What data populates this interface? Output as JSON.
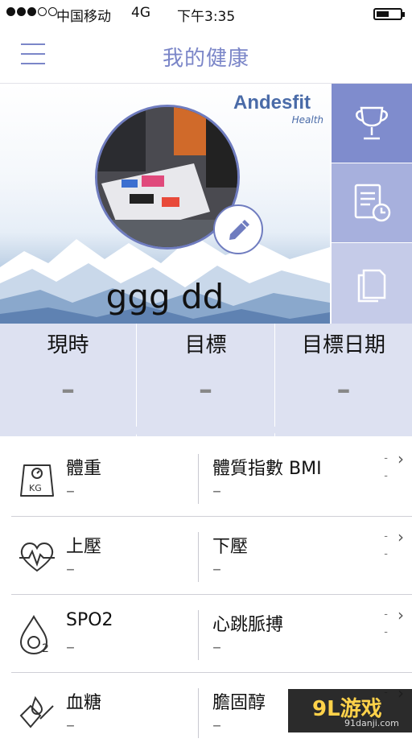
{
  "status_bar": {
    "carrier": "中国移动",
    "network": "4G",
    "time": "下午3:35",
    "signal_bars_on": 3,
    "battery_level": 0.55
  },
  "header": {
    "title": "我的健康",
    "menu_icon": "hamburger-menu-icon"
  },
  "profile": {
    "brand_name": "Andesfit",
    "brand_sub": "Health",
    "username": "ggg dd",
    "edit_icon": "pencil-icon"
  },
  "side_tabs": [
    {
      "icon": "trophy-icon"
    },
    {
      "icon": "report-clock-icon"
    },
    {
      "icon": "documents-icon"
    }
  ],
  "summary": {
    "current_label": "現時",
    "current_value": "–",
    "target_label": "目標",
    "target_value": "–",
    "target_date_label": "目標日期",
    "target_date_value": "–"
  },
  "rows": [
    {
      "icon": "scale-icon",
      "left_name": "體重",
      "left_value": "–",
      "right_name": "體質指數 BMI",
      "right_value": "–",
      "d1": "-",
      "d2": "-"
    },
    {
      "icon": "heart-pulse-icon",
      "left_name": "上壓",
      "left_value": "–",
      "right_name": "下壓",
      "right_value": "–",
      "d1": "-",
      "d2": "-"
    },
    {
      "icon": "oxygen-drop-icon",
      "left_name": "SPO2",
      "left_value": "–",
      "right_name": "心跳脈搏",
      "right_value": "–",
      "d1": "-",
      "d2": "-"
    },
    {
      "icon": "blood-sugar-icon",
      "left_name": "血糖",
      "left_value": "–",
      "right_name": "膽固醇",
      "right_value": "–",
      "d1": "-",
      "d2": "-"
    }
  ],
  "watermark": {
    "logo_main": "9L游戏",
    "logo_site": "91danji.com"
  },
  "colors": {
    "accent": "#7b86c8",
    "tab_dark": "#7f8ccd",
    "tab_mid": "#a7b0dd",
    "tab_light": "#c5cbe8",
    "summary_bg": "#dde1f1"
  }
}
